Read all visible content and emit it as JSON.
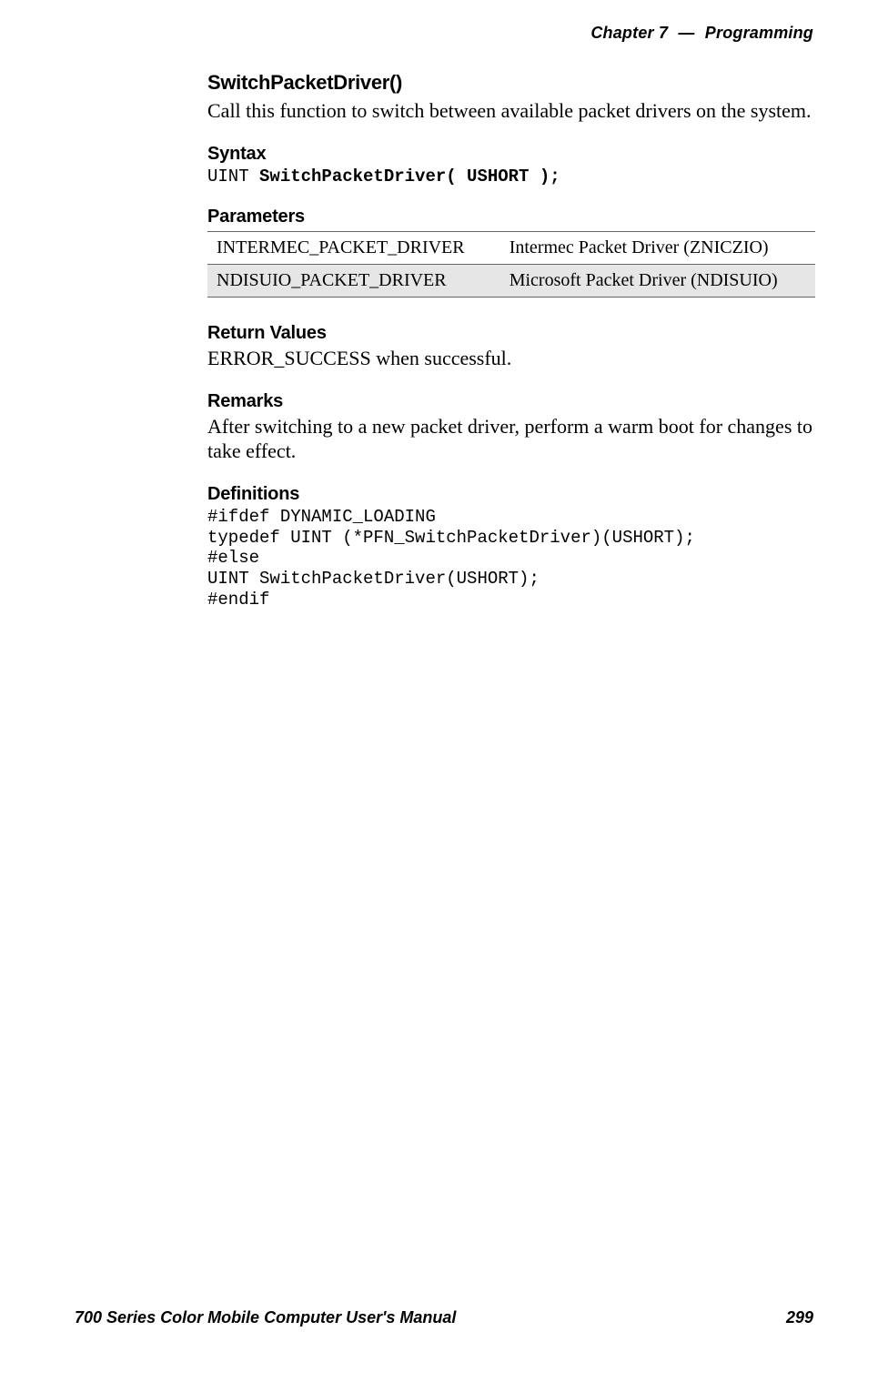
{
  "header": {
    "chapter_label": "Chapter",
    "chapter_number": "7",
    "dash": "—",
    "topic": "Programming"
  },
  "section": {
    "func_title": "SwitchPacketDriver()",
    "func_desc": "Call this function to switch between available packet drivers on the system.",
    "syntax": {
      "heading": "Syntax",
      "code_prefix": "UINT ",
      "code_bold": "SwitchPacketDriver( USHORT );"
    },
    "parameters": {
      "heading": "Parameters",
      "rows": [
        {
          "name": "INTERMEC_PACKET_DRIVER",
          "desc": "Intermec Packet Driver (ZNICZIO)"
        },
        {
          "name": "NDISUIO_PACKET_DRIVER",
          "desc": "Microsoft Packet Driver (NDISUIO)"
        }
      ]
    },
    "return_values": {
      "heading": "Return Values",
      "text": "ERROR_SUCCESS when successful."
    },
    "remarks": {
      "heading": "Remarks",
      "text": "After switching to a new packet driver, perform a warm boot for changes to take effect."
    },
    "definitions": {
      "heading": "Definitions",
      "code": "#ifdef DYNAMIC_LOADING\ntypedef UINT (*PFN_SwitchPacketDriver)(USHORT);\n#else\nUINT SwitchPacketDriver(USHORT);\n#endif"
    }
  },
  "footer": {
    "title": "700 Series Color Mobile Computer User's Manual",
    "page_number": "299"
  }
}
